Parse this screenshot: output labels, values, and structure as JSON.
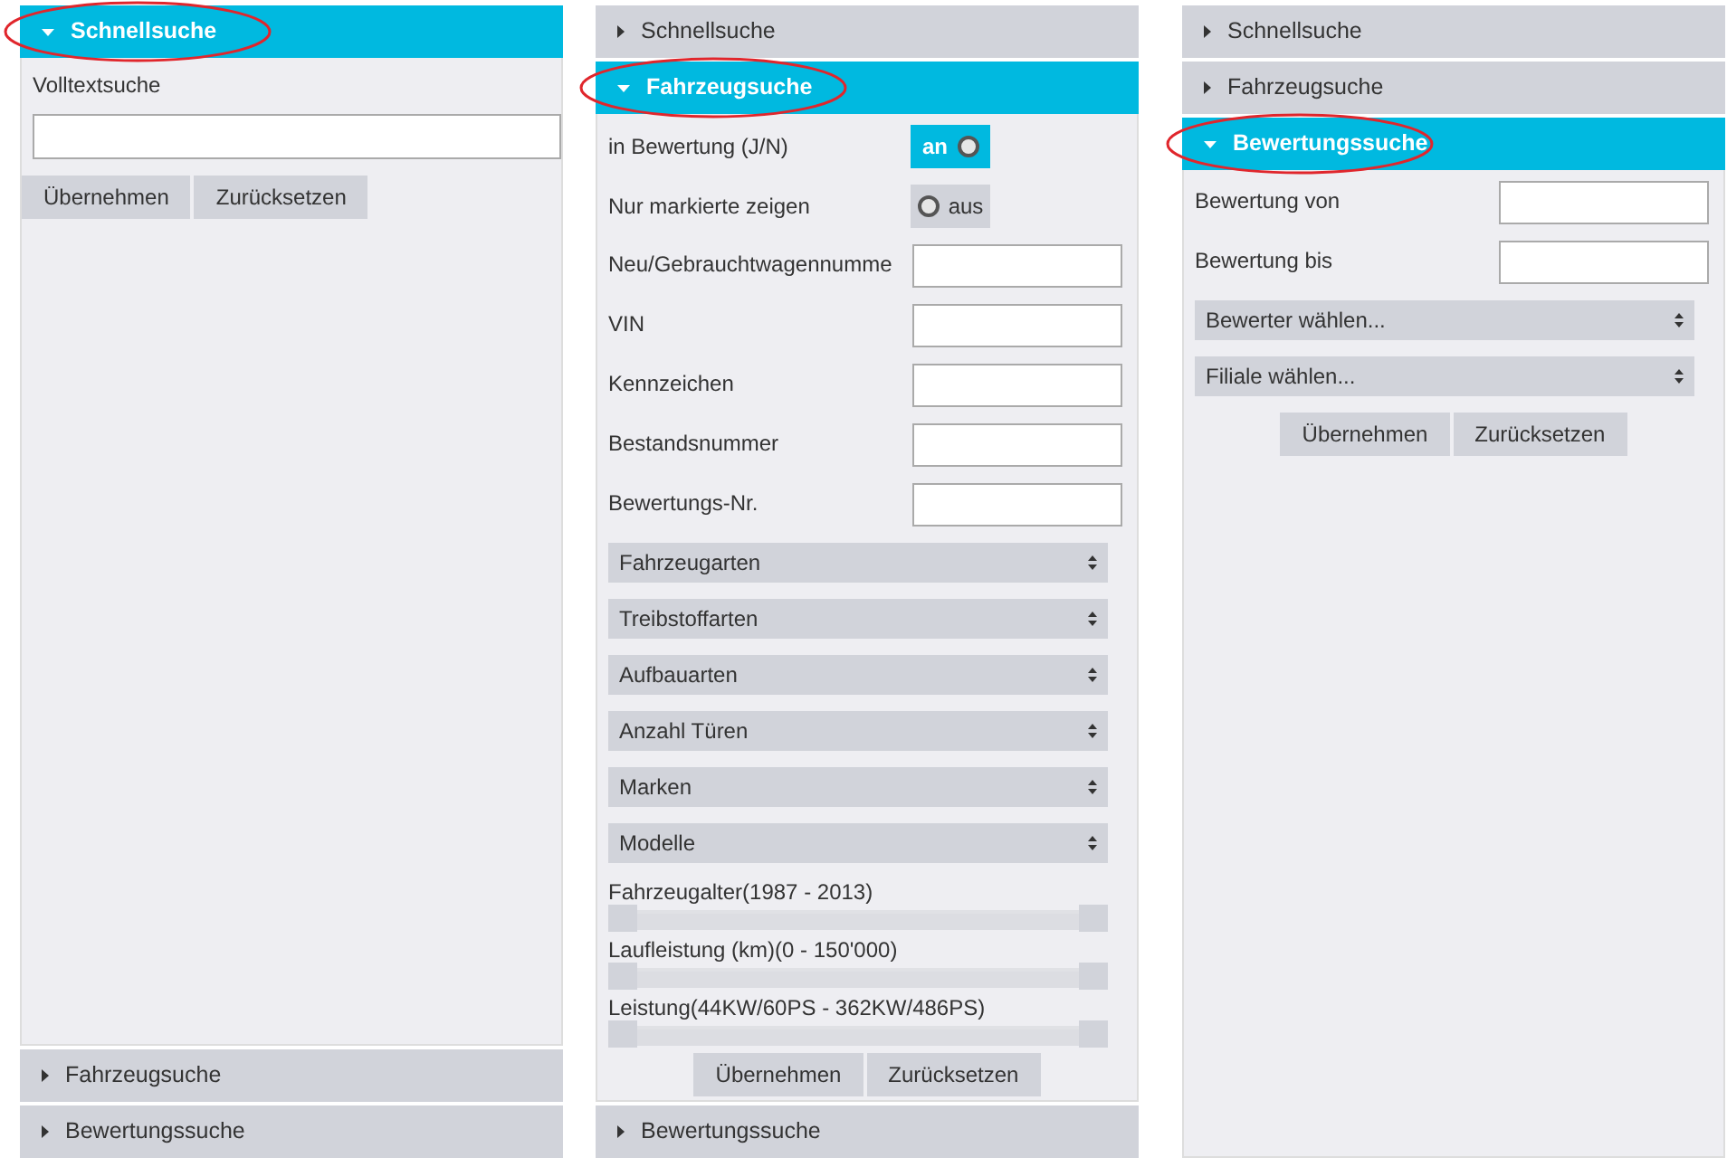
{
  "panels": [
    {
      "sections": [
        {
          "title": "Schnellsuche",
          "expanded": true,
          "circled": true,
          "fields": [
            {
              "kind": "wide_field",
              "label": "Volltextsuche"
            }
          ],
          "buttons": [
            "Übernehmen",
            "Zurücksetzen"
          ]
        },
        {
          "title": "Fahrzeugsuche",
          "expanded": false,
          "circled": false
        },
        {
          "title": "Bewertungssuche",
          "expanded": false,
          "circled": false
        }
      ]
    },
    {
      "sections": [
        {
          "title": "Schnellsuche",
          "expanded": false,
          "circled": false
        },
        {
          "title": "Fahrzeugsuche",
          "expanded": true,
          "circled": true,
          "fields": [
            {
              "kind": "toggle",
              "label": "in Bewertung (J/N)",
              "on": true,
              "text": "an"
            },
            {
              "kind": "toggle",
              "label": "Nur markierte zeigen",
              "on": false,
              "text": "aus"
            },
            {
              "kind": "field",
              "label": "Neu/Gebrauchtwagennumme"
            },
            {
              "kind": "field",
              "label": "VIN"
            },
            {
              "kind": "field",
              "label": "Kennzeichen"
            },
            {
              "kind": "field",
              "label": "Bestandsnummer"
            },
            {
              "kind": "field",
              "label": "Bewertungs-Nr."
            },
            {
              "kind": "select",
              "label": "Fahrzeugarten"
            },
            {
              "kind": "select",
              "label": "Treibstoffarten"
            },
            {
              "kind": "select",
              "label": "Aufbauarten"
            },
            {
              "kind": "select",
              "label": "Anzahl Türen"
            },
            {
              "kind": "select",
              "label": "Marken"
            },
            {
              "kind": "select",
              "label": "Modelle"
            },
            {
              "kind": "slider",
              "label": "Fahrzeugalter(1987 - 2013)",
              "level": 1
            },
            {
              "kind": "slider",
              "label": "Laufleistung (km)(0 - 150'000)",
              "level": 1
            },
            {
              "kind": "slider",
              "label": "Leistung(44KW/60PS - 362KW/486PS)",
              "level": 1
            }
          ],
          "buttons": [
            "Übernehmen",
            "Zurücksetzen"
          ]
        },
        {
          "title": "Bewertungssuche",
          "expanded": false,
          "circled": false
        }
      ]
    },
    {
      "sections": [
        {
          "title": "Schnellsuche",
          "expanded": false,
          "circled": false
        },
        {
          "title": "Fahrzeugsuche",
          "expanded": false,
          "circled": false
        },
        {
          "title": "Bewertungssuche",
          "expanded": true,
          "circled": true,
          "fields": [
            {
              "kind": "field",
              "label": "Bewertung von"
            },
            {
              "kind": "field",
              "label": "Bewertung bis"
            },
            {
              "kind": "select",
              "label": "Bewerter wählen..."
            },
            {
              "kind": "select",
              "label": "Filiale wählen..."
            }
          ],
          "buttons": [
            "Übernehmen",
            "Zurücksetzen"
          ]
        }
      ]
    }
  ]
}
